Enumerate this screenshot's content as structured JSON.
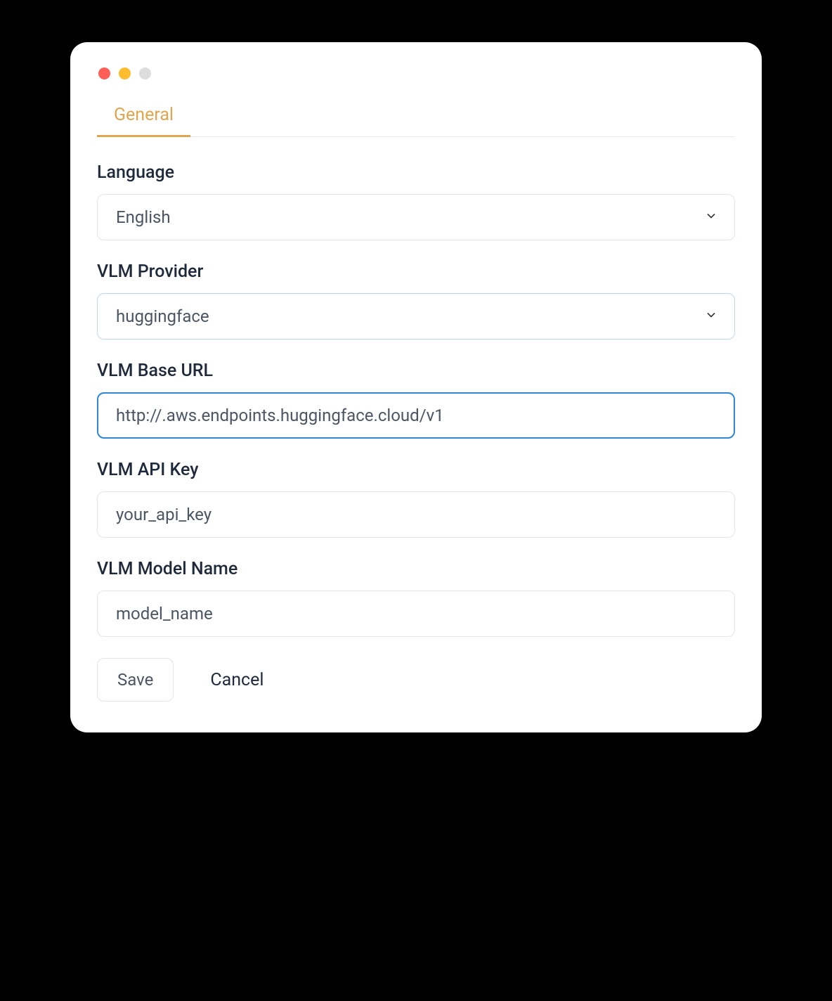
{
  "tabs": {
    "general": "General"
  },
  "fields": {
    "language": {
      "label": "Language",
      "value": "English"
    },
    "vlm_provider": {
      "label": "VLM Provider",
      "value": "huggingface"
    },
    "vlm_base_url": {
      "label": "VLM Base URL",
      "value": "http://.aws.endpoints.huggingface.cloud/v1"
    },
    "vlm_api_key": {
      "label": "VLM API Key",
      "value": "your_api_key"
    },
    "vlm_model_name": {
      "label": "VLM Model Name",
      "value": "model_name"
    }
  },
  "actions": {
    "save": "Save",
    "cancel": "Cancel"
  }
}
